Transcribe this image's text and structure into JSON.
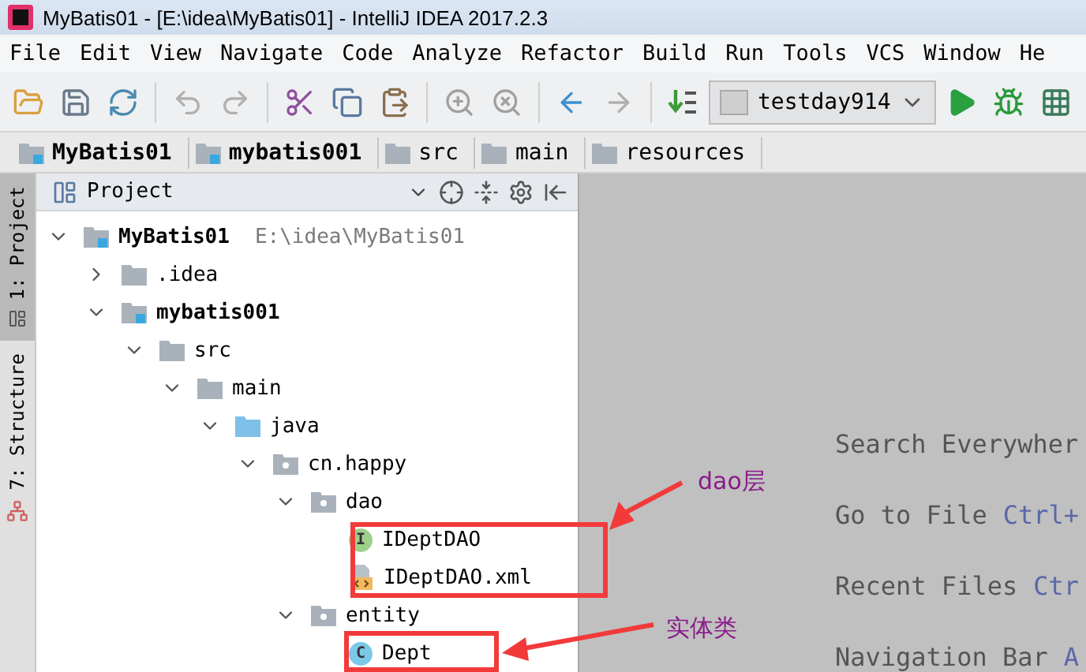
{
  "window": {
    "title": "MyBatis01 - [E:\\idea\\MyBatis01] - IntelliJ IDEA 2017.2.3"
  },
  "menu": [
    "File",
    "Edit",
    "View",
    "Navigate",
    "Code",
    "Analyze",
    "Refactor",
    "Build",
    "Run",
    "Tools",
    "VCS",
    "Window",
    "He"
  ],
  "toolbar": {
    "run_config": "testday914"
  },
  "breadcrumbs": [
    {
      "label": "MyBatis01",
      "kind": "module"
    },
    {
      "label": "mybatis001",
      "kind": "module"
    },
    {
      "label": "src",
      "kind": "folder"
    },
    {
      "label": "main",
      "kind": "folder"
    },
    {
      "label": "resources",
      "kind": "resources"
    }
  ],
  "side_tabs": [
    {
      "label": "1: Project",
      "selected": true
    },
    {
      "label": "7: Structure",
      "selected": false
    }
  ],
  "project_panel": {
    "title": "Project",
    "tree": [
      {
        "label": "MyBatis01",
        "kind": "module",
        "bold": true,
        "hint": "E:\\idea\\MyBatis01",
        "expanded": true,
        "children": [
          {
            "label": ".idea",
            "kind": "folder",
            "expanded": false
          },
          {
            "label": "mybatis001",
            "kind": "module",
            "bold": true,
            "expanded": true,
            "children": [
              {
                "label": "src",
                "kind": "folder",
                "expanded": true,
                "children": [
                  {
                    "label": "main",
                    "kind": "folder",
                    "expanded": true,
                    "children": [
                      {
                        "label": "java",
                        "kind": "source",
                        "expanded": true,
                        "children": [
                          {
                            "label": "cn.happy",
                            "kind": "package",
                            "expanded": true,
                            "children": [
                              {
                                "label": "dao",
                                "kind": "package",
                                "expanded": true,
                                "children": [
                                  {
                                    "label": "IDeptDAO",
                                    "kind": "interface",
                                    "badge": "I"
                                  },
                                  {
                                    "label": "IDeptDAO.xml",
                                    "kind": "xml"
                                  }
                                ]
                              },
                              {
                                "label": "entity",
                                "kind": "package",
                                "expanded": true,
                                "children": [
                                  {
                                    "label": "Dept",
                                    "kind": "class",
                                    "badge": "C"
                                  }
                                ]
                              }
                            ]
                          }
                        ]
                      }
                    ]
                  }
                ]
              }
            ]
          }
        ]
      }
    ]
  },
  "editor_hints": [
    {
      "action": "Search Everywher"
    },
    {
      "action": "Go to File",
      "shortcut": "Ctrl+"
    },
    {
      "action": "Recent Files",
      "shortcut": "Ctr"
    },
    {
      "action": "Navigation Bar",
      "shortcut": "A"
    }
  ],
  "annotations": [
    {
      "label": "dao层"
    },
    {
      "label": "实体类"
    }
  ]
}
